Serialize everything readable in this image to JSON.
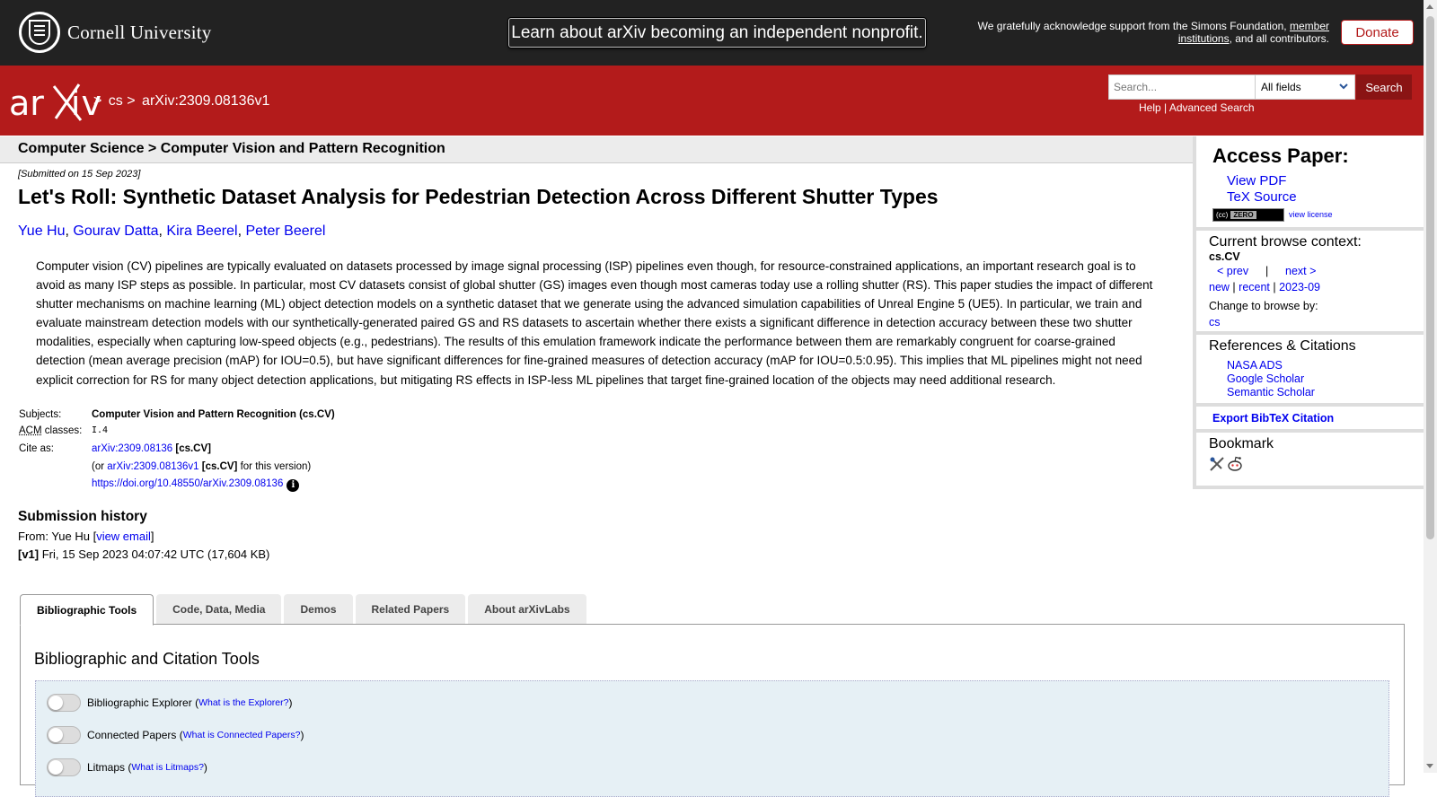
{
  "topbar": {
    "university": "Cornell University",
    "nonprofit_label": "Learn about arXiv becoming an independent nonprofit.",
    "ack_prefix": "We gratefully acknowledge support from the Simons Foundation,",
    "ack_link": "member institutions",
    "ack_suffix": ", and all contributors.",
    "donate_label": "Donate"
  },
  "header": {
    "logo": "arxiv",
    "crumb_sep": ">",
    "crumb_cs": "cs",
    "crumb_id": "arXiv:2309.08136v1",
    "search_placeholder": "Search...",
    "search_field": "All fields",
    "search_button": "Search",
    "help": "Help",
    "pipe": "|",
    "advanced": "Advanced Search"
  },
  "paper": {
    "category_path": "Computer Science > Computer Vision and Pattern Recognition",
    "submitted": "[Submitted on 15 Sep 2023]",
    "title": "Let's Roll: Synthetic Dataset Analysis for Pedestrian Detection Across Different Shutter Types",
    "authors": [
      "Yue Hu",
      "Gourav Datta",
      "Kira Beerel",
      "Peter Beerel"
    ],
    "abstract": "Computer vision (CV) pipelines are typically evaluated on datasets processed by image signal processing (ISP) pipelines even though, for resource-constrained applications, an important research goal is to avoid as many ISP steps as possible. In particular, most CV datasets consist of global shutter (GS) images even though most cameras today use a rolling shutter (RS). This paper studies the impact of different shutter mechanisms on machine learning (ML) object detection models on a synthetic dataset that we generate using the advanced simulation capabilities of Unreal Engine 5 (UE5). In particular, we train and evaluate mainstream detection models with our synthetically-generated paired GS and RS datasets to ascertain whether there exists a significant difference in detection accuracy between these two shutter modalities, especially when capturing low-speed objects (e.g., pedestrians). The results of this emulation framework indicate the performance between them are remarkably congruent for coarse-grained detection (mean average precision (mAP) for IOU=0.5), but have significant differences for fine-grained measures of detection accuracy (mAP for IOU=0.5:0.95). This implies that ML pipelines might not need explicit correction for RS for many object detection applications, but mitigating RS effects in ISP-less ML pipelines that target fine-grained location of the objects may need additional research."
  },
  "metadata": {
    "subjects_label": "Subjects:",
    "subjects_value": "Computer Vision and Pattern Recognition (cs.CV)",
    "acm_abbr": "ACM",
    "acm_label": " classes:",
    "acm_value": "I.4",
    "cite_label": "Cite as:",
    "cite_id": "arXiv:2309.08136",
    "cite_cat": "[cs.CV]",
    "cite_v_prefix": "(or ",
    "cite_v_id": "arXiv:2309.08136v1",
    "cite_v_cat": "[cs.CV]",
    "cite_v_suffix": " for this version)",
    "doi": "https://doi.org/10.48550/arXiv.2309.08136",
    "info_icon": "i"
  },
  "history": {
    "title": "Submission history",
    "from_prefix": "From: Yue Hu [",
    "view_email": "view email",
    "from_suffix": "]",
    "v1_label": "[v1]",
    "v1_text": " Fri, 15 Sep 2023 04:07:42 UTC (17,604 KB)"
  },
  "tabs": [
    "Bibliographic Tools",
    "Code, Data, Media",
    "Demos",
    "Related Papers",
    "About arXivLabs"
  ],
  "tools": {
    "heading": "Bibliographic and Citation Tools",
    "items": [
      {
        "label": "Bibliographic Explorer",
        "help": "What is the Explorer?"
      },
      {
        "label": "Connected Papers",
        "help": "What is Connected Papers?"
      },
      {
        "label": "Litmaps",
        "help": "What is Litmaps?"
      }
    ]
  },
  "sidebar": {
    "access_title": "Access Paper:",
    "view_pdf": "View PDF",
    "tex_source": "TeX Source",
    "license_badge": "ZERO",
    "view_license": "view license",
    "browse_title": "Current browse context:",
    "browse_context": "cs.CV",
    "prev": "< prev",
    "sep_bar": "|",
    "next": "next >",
    "new": "new",
    "recent": "recent",
    "month": "2023-09",
    "change_label": "Change to browse by:",
    "change_cs": "cs",
    "refs_title": "References & Citations",
    "nasa": "NASA ADS",
    "google": "Google Scholar",
    "semantic": "Semantic Scholar",
    "bibtex": "Export BibTeX Citation",
    "bookmark_title": "Bookmark"
  },
  "colors": {
    "arxiv_red": "#b31b1b",
    "top_bar": "#222222",
    "link_blue": "#0000ee"
  }
}
